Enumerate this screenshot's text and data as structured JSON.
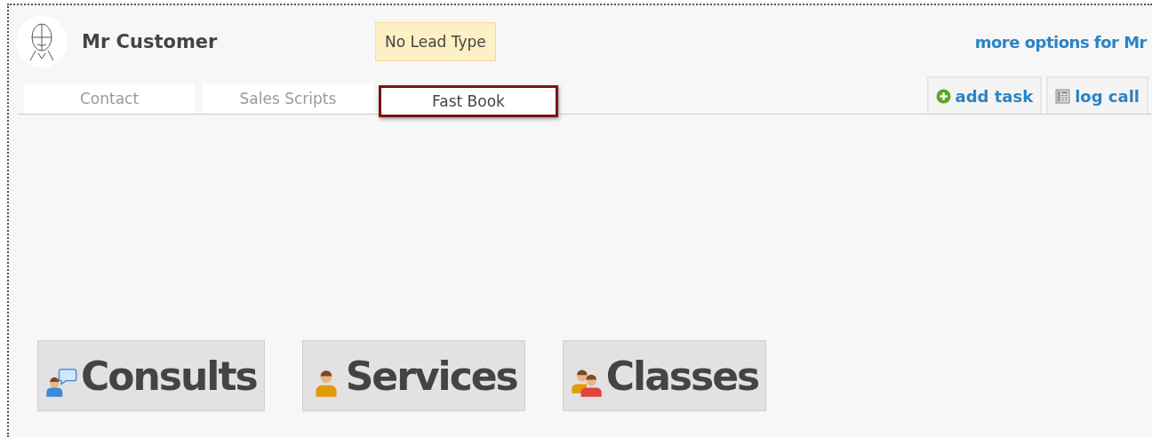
{
  "customer": {
    "name": "Mr Customer",
    "lead_type": "No Lead Type",
    "more_options": "more options for Mr"
  },
  "tabs": [
    {
      "label": "Contact",
      "selected": false
    },
    {
      "label": "Sales Scripts",
      "selected": false
    },
    {
      "label": "Fast Book",
      "selected": true
    }
  ],
  "actions": [
    {
      "label": "add task",
      "kind": "task"
    },
    {
      "label": "log call",
      "kind": "call"
    }
  ],
  "booking_buttons": [
    {
      "label": "Consults",
      "kind": "consult"
    },
    {
      "label": "Services",
      "kind": "service"
    },
    {
      "label": "Classes",
      "kind": "class"
    }
  ]
}
